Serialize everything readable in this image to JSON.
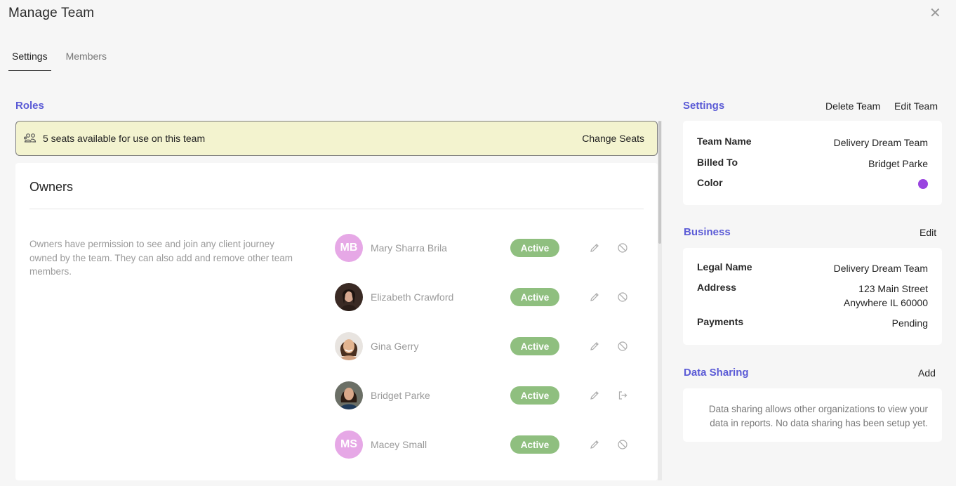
{
  "header": {
    "title": "Manage Team",
    "close_icon": "close-icon"
  },
  "tabs": [
    {
      "label": "Settings",
      "active": true
    },
    {
      "label": "Members",
      "active": false
    }
  ],
  "roles": {
    "title": "Roles",
    "seats_text": "5 seats available for use on this team",
    "change_seats": "Change Seats",
    "owners": {
      "title": "Owners",
      "description": "Owners have permission to see and join any client journey owned by the team. They can also add and remove other team members.",
      "members": [
        {
          "name": "Mary Sharra Brila",
          "initials": "MB",
          "status": "Active",
          "action_icon": "block-icon"
        },
        {
          "name": "Elizabeth Crawford",
          "initials": "",
          "status": "Active",
          "action_icon": "block-icon"
        },
        {
          "name": "Gina Gerry",
          "initials": "",
          "status": "Active",
          "action_icon": "block-icon"
        },
        {
          "name": "Bridget Parke",
          "initials": "",
          "status": "Active",
          "action_icon": "leave-icon"
        },
        {
          "name": "Macey Small",
          "initials": "MS",
          "status": "Active",
          "action_icon": "block-icon"
        }
      ]
    }
  },
  "settings": {
    "title": "Settings",
    "delete_team": "Delete Team",
    "edit_team": "Edit Team",
    "team_name_label": "Team Name",
    "team_name": "Delivery Dream Team",
    "billed_to_label": "Billed To",
    "billed_to": "Bridget Parke",
    "color_label": "Color",
    "color": "#9a44e0"
  },
  "business": {
    "title": "Business",
    "edit": "Edit",
    "legal_name_label": "Legal Name",
    "legal_name": "Delivery Dream Team",
    "address_label": "Address",
    "address_line1": "123 Main Street",
    "address_line2": "Anywhere IL 60000",
    "payments_label": "Payments",
    "payments": "Pending"
  },
  "data_sharing": {
    "title": "Data Sharing",
    "add": "Add",
    "text": "Data sharing allows other organizations to view your data in reports. No data sharing has been setup yet."
  }
}
